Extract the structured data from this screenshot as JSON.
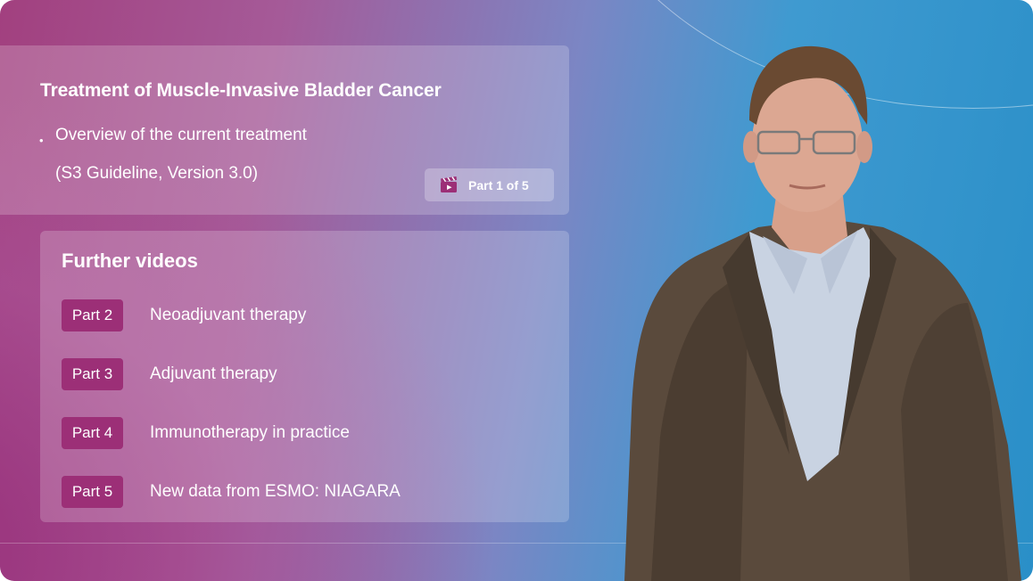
{
  "colors": {
    "brand_magenta": "#9c2f77",
    "background_blue": "#2a8fc8",
    "background_pink": "#a2407f"
  },
  "header": {
    "title": "Treatment of Muscle-Invasive Bladder Cancer",
    "bullet": "Overview of the current treatment",
    "subline": "(S3 Guideline, Version 3.0)",
    "part_indicator": {
      "icon": "clapperboard-icon",
      "label": "Part 1 of 5"
    }
  },
  "further_videos": {
    "title": "Further videos",
    "items": [
      {
        "badge": "Part 2",
        "label": "Neoadjuvant therapy"
      },
      {
        "badge": "Part 3",
        "label": "Adjuvant therapy"
      },
      {
        "badge": "Part 4",
        "label": "Immunotherapy in practice"
      },
      {
        "badge": "Part 5",
        "label": "New data from ESMO: NIAGARA"
      }
    ]
  }
}
